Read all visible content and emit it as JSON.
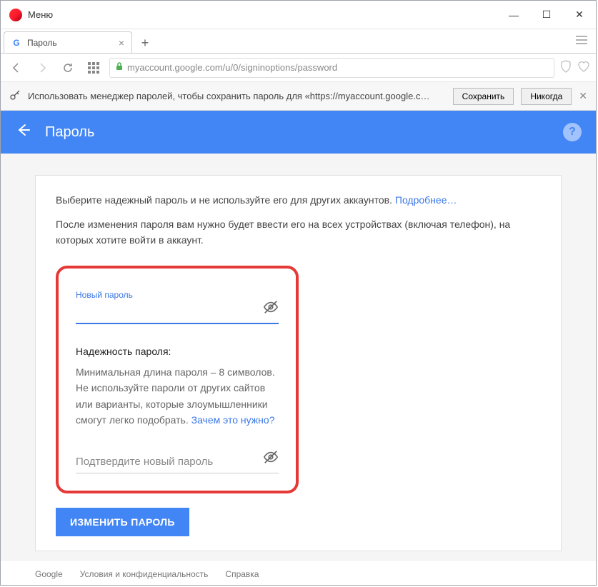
{
  "window": {
    "menu_label": "Меню",
    "tab_title": "Пароль",
    "url": "myaccount.google.com/u/0/signinoptions/password"
  },
  "save_bar": {
    "text": "Использовать менеджер паролей, чтобы сохранить пароль для «https://myaccount.google.c…",
    "save": "Сохранить",
    "never": "Никогда"
  },
  "header": {
    "title": "Пароль"
  },
  "content": {
    "line1_a": "Выберите надежный пароль и не используйте его для других аккаунтов. ",
    "line1_link": "Подробнее…",
    "line2": "После изменения пароля вам нужно будет ввести его на всех устройствах (включая телефон), на которых хотите войти в аккаунт.",
    "new_password_label": "Новый пароль",
    "strength_title": "Надежность пароля:",
    "strength_text_a": "Минимальная длина пароля – 8 символов. Не используйте пароли от других сайтов или варианты, которые злоумышленники смогут легко подобрать. ",
    "strength_link": "Зачем это нужно?",
    "confirm_placeholder": "Подтвердите новый пароль",
    "change_button": "ИЗМЕНИТЬ ПАРОЛЬ"
  },
  "footer": {
    "google": "Google",
    "privacy": "Условия и конфиденциальность",
    "help": "Справка"
  }
}
